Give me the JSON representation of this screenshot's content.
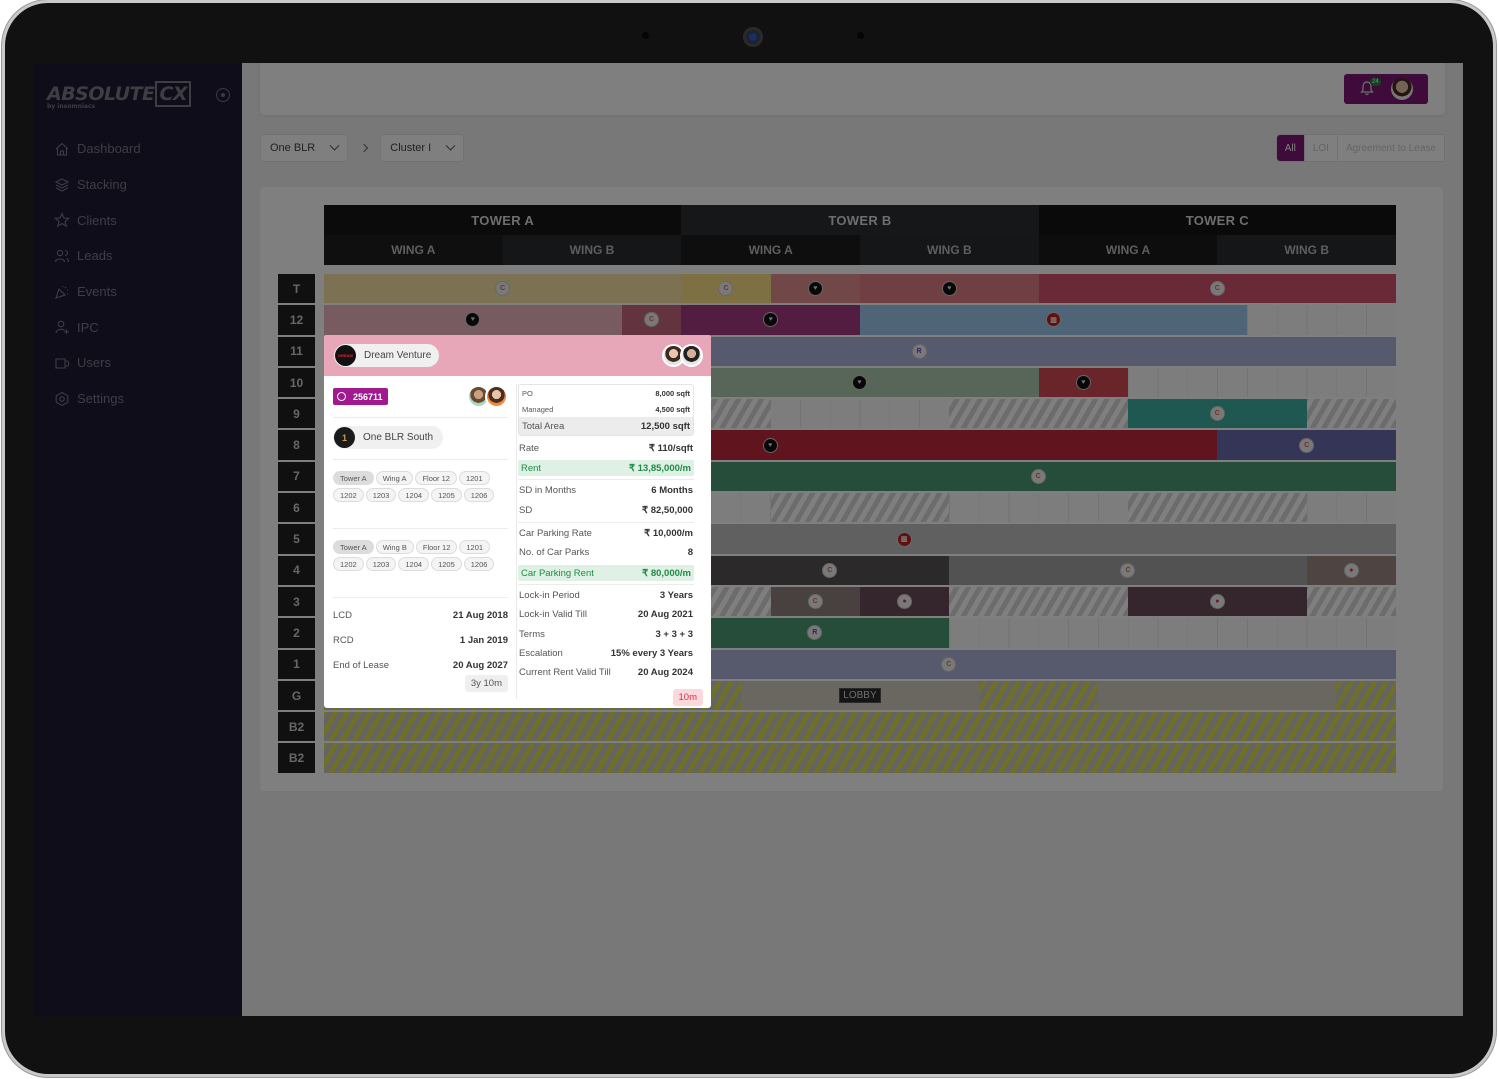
{
  "app": {
    "logo_text": "ABSOLUTE",
    "logo_mark": "CX",
    "logo_byline": "by insomniacs"
  },
  "sidebar": {
    "items": [
      {
        "label": "Dashboard",
        "icon": "home-icon"
      },
      {
        "label": "Stacking",
        "icon": "layers-icon"
      },
      {
        "label": "Clients",
        "icon": "star-icon"
      },
      {
        "label": "Leads",
        "icon": "users-icon"
      },
      {
        "label": "Events",
        "icon": "party-icon"
      },
      {
        "label": "IPC",
        "icon": "user-plus-icon"
      },
      {
        "label": "Users",
        "icon": "mug-icon"
      },
      {
        "label": "Settings",
        "icon": "hexagon-gear-icon"
      }
    ]
  },
  "header": {
    "notification_count": "24"
  },
  "breadcrumb": {
    "property": "One BLR",
    "cluster": "Cluster I"
  },
  "filters": {
    "options": [
      "All",
      "LOI",
      "Agreement to Lease"
    ],
    "selected": "All"
  },
  "colors": {
    "accent": "#7d1776",
    "sidebar_bg": "#1c1a33",
    "popup_header": "#e8a7b9",
    "rent_green": "#1e8a47"
  },
  "stacking": {
    "towers": [
      {
        "name": "TOWER A",
        "wings": [
          "WING A",
          "WING B"
        ]
      },
      {
        "name": "TOWER B",
        "wings": [
          "WING A",
          "WING B"
        ]
      },
      {
        "name": "TOWER C",
        "wings": [
          "WING A",
          "WING B"
        ]
      }
    ],
    "floors": [
      {
        "label": "T",
        "segments": [
          {
            "start": 0,
            "end": 12,
            "color": "#fbe3a6",
            "logo": "c"
          },
          {
            "start": 12,
            "end": 15,
            "color": "#fbe286",
            "logo": "c"
          },
          {
            "start": 15,
            "end": 18,
            "color": "#e28f8f",
            "logo": "dark"
          },
          {
            "start": 18,
            "end": 24,
            "color": "#e07e86",
            "logo": "dark"
          },
          {
            "start": 24,
            "end": 36,
            "color": "#d3526c",
            "logo": "c"
          }
        ],
        "logo_pos": [
          6,
          18,
          13.5,
          16.5,
          21,
          30
        ]
      },
      {
        "label": "12",
        "segments": [
          {
            "start": 0,
            "end": 10,
            "color": "#f1b6c2",
            "logo": "dark"
          },
          {
            "start": 10,
            "end": 12,
            "color": "#c7697f",
            "logo": "c"
          },
          {
            "start": 12,
            "end": 18,
            "color": "#a73b84",
            "logo": "dark"
          },
          {
            "start": 18,
            "end": 31,
            "color": "#9ec9ec",
            "logo": "red"
          }
        ]
      },
      {
        "label": "11",
        "segments": [
          {
            "start": 0,
            "end": 36,
            "color": "#adb4d8",
            "logo": "r",
            "logo_at": 20
          }
        ]
      },
      {
        "label": "10",
        "segments": [
          {
            "start": 0,
            "end": 24,
            "color": "#b0ccb2",
            "logo": "dark",
            "logo_at": 18
          },
          {
            "start": 24,
            "end": 27,
            "color": "#d54a55",
            "logo": "dark"
          }
        ]
      },
      {
        "label": "9",
        "segments": [
          {
            "start": 0,
            "end": 15,
            "hatch": "gray"
          },
          {
            "start": 21,
            "end": 27,
            "hatch": "gray"
          },
          {
            "start": 27,
            "end": 33,
            "color": "#3eafa3",
            "logo": "c"
          },
          {
            "start": 33,
            "end": 36,
            "hatch": "gray"
          }
        ]
      },
      {
        "label": "8",
        "segments": [
          {
            "start": 0,
            "end": 30,
            "color": "#be283c",
            "logo": "dark",
            "logo_at": 15
          },
          {
            "start": 30,
            "end": 36,
            "color": "#6a6aaf",
            "logo": "c"
          }
        ]
      },
      {
        "label": "7",
        "segments": [
          {
            "start": 0,
            "end": 36,
            "color": "#4a9a73",
            "logo": "c",
            "logo_at": 24
          }
        ]
      },
      {
        "label": "6",
        "segments": [
          {
            "start": 15,
            "end": 21,
            "hatch": "gray"
          },
          {
            "start": 27,
            "end": 33,
            "hatch": "gray"
          }
        ]
      },
      {
        "label": "5",
        "segments": [
          {
            "start": 0,
            "end": 36,
            "color": "#c1c1c1",
            "logo": "red",
            "logo_at": 19.5
          }
        ]
      },
      {
        "label": "4",
        "segments": [
          {
            "start": 0,
            "end": 21,
            "color": "#575353",
            "logo": "c",
            "logo_at": 17
          },
          {
            "start": 21,
            "end": 33,
            "color": "#a4a4a4",
            "logo": "c"
          },
          {
            "start": 33,
            "end": 36,
            "color": "#9c8a87",
            "logo": "donut"
          }
        ]
      },
      {
        "label": "3",
        "segments": [
          {
            "start": 0,
            "end": 15,
            "hatch": "gray"
          },
          {
            "start": 15,
            "end": 18,
            "color": "#938381",
            "logo": "c"
          },
          {
            "start": 18,
            "end": 21,
            "color": "#6b4c5b",
            "logo": "donut"
          },
          {
            "start": 21,
            "end": 27,
            "hatch": "gray"
          },
          {
            "start": 27,
            "end": 33,
            "color": "#6b4c5b",
            "logo": "donut"
          },
          {
            "start": 33,
            "end": 36,
            "hatch": "gray"
          }
        ]
      },
      {
        "label": "2",
        "segments": [
          {
            "start": 0,
            "end": 21,
            "color": "#4a9a73",
            "logo": "r",
            "logo_at": 16.5
          }
        ]
      },
      {
        "label": "1",
        "segments": [
          {
            "start": 0,
            "end": 36,
            "color": "#adb4d8",
            "logo": "c",
            "logo_at": 21
          }
        ]
      },
      {
        "label": "G",
        "segments": [
          {
            "start": 0,
            "end": 14,
            "hatch": "yellow"
          },
          {
            "start": 14,
            "end": 22,
            "color": "#d4cdc1",
            "lobby": true
          },
          {
            "start": 22,
            "end": 26,
            "hatch": "yellow"
          },
          {
            "start": 26,
            "end": 34,
            "color": "#d4cdc1"
          },
          {
            "start": 34,
            "end": 36,
            "hatch": "yellow"
          }
        ]
      },
      {
        "label": "B2",
        "segments": [
          {
            "start": 0,
            "end": 36,
            "hatch": "yellow"
          }
        ]
      },
      {
        "label": "B2",
        "segments": [
          {
            "start": 0,
            "end": 36,
            "hatch": "yellow"
          }
        ]
      }
    ],
    "lobby_label": "LOBBY"
  },
  "popup": {
    "client_name": "Dream Venture",
    "deal_id": "256711",
    "building": "One BLR South",
    "unit_groups": [
      {
        "tower": "Tower A",
        "wing": "Wing A",
        "floor": "Floor 12",
        "units": [
          "1201",
          "1202",
          "1203",
          "1204",
          "1205",
          "1206"
        ]
      },
      {
        "tower": "Tower A",
        "wing": "Wing B",
        "floor": "Floor 12",
        "units": [
          "1201",
          "1202",
          "1203",
          "1204",
          "1205",
          "1206"
        ]
      }
    ],
    "dates": [
      {
        "label": "LCD",
        "value": "21 Aug 2018"
      },
      {
        "label": "RCD",
        "value": "1 Jan 2019"
      },
      {
        "label": "End of Lease",
        "value": "20 Aug 2027"
      }
    ],
    "remaining": "3y 10m",
    "area": {
      "po_label": "PO",
      "po_value": "8,000 sqft",
      "managed_label": "Managed",
      "managed_value": "4,500 sqft",
      "total_label": "Total Area",
      "total_value": "12,500 sqft"
    },
    "rate_label": "Rate",
    "rate_value": "₹ 110/sqft",
    "rent_label": "Rent",
    "rent_value": "₹ 13,85,000/m",
    "sd_months_label": "SD in Months",
    "sd_months_value": "6 Months",
    "sd_label": "SD",
    "sd_value": "₹ 82,50,000",
    "cp_rate_label": "Car Parking Rate",
    "cp_rate_value": "₹ 10,000/m",
    "cp_count_label": "No. of Car Parks",
    "cp_count_value": "8",
    "cp_rent_label": "Car Parking Rent",
    "cp_rent_value": "₹ 80,000/m",
    "lockin_label": "Lock-in Period",
    "lockin_value": "3 Years",
    "lockin_till_label": "Lock-in Valid Till",
    "lockin_till_value": "20 Aug 2021",
    "terms_label": "Terms",
    "terms_value": "3 + 3 + 3",
    "escalation_label": "Escalation",
    "escalation_value": "15% every 3 Years",
    "current_rent_label": "Current Rent Valid Till",
    "current_rent_value": "20 Aug 2024",
    "current_rent_remaining": "10m"
  }
}
